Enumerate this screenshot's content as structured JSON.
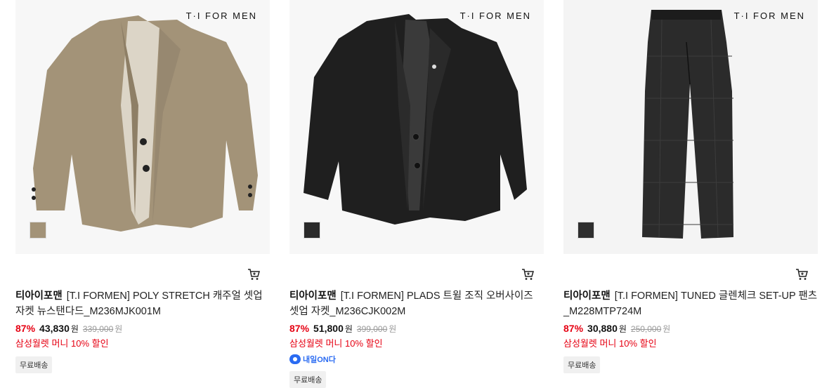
{
  "products": [
    {
      "brand_mark": "T·I FOR MEN",
      "brand": "티아이포맨",
      "title": "[T.I FORMEN] POLY STRETCH 캐주얼 셋업 자켓 뉴스탠다드_M236MJK001M",
      "discount": "87%",
      "price": "43,830",
      "price_unit": "원",
      "original_price": "339,000",
      "original_unit": "원",
      "benefit": "삼성월렛 머니 10% 할인",
      "shipping_badge": "무료배송",
      "swatch_color": "#a39378",
      "garment_color": "#a39378"
    },
    {
      "brand_mark": "T·I FOR MEN",
      "brand": "티아이포맨",
      "title": "[T.I FORMEN] PLADS 트윌 조직 오버사이즈 셋업 자켓_M236CJK002M",
      "discount": "87%",
      "price": "51,800",
      "price_unit": "원",
      "original_price": "399,000",
      "original_unit": "원",
      "benefit": "삼성월렛 머니 10% 할인",
      "delivery_tag": "내일ON다",
      "shipping_badge": "무료배송",
      "swatch_color": "#2a2a2a",
      "garment_color": "#1f1f1f"
    },
    {
      "brand_mark": "T·I FOR MEN",
      "brand": "티아이포맨",
      "title": "[T.I FORMEN] TUNED 글렌체크 SET-UP 팬츠_M228MTP724M",
      "discount": "87%",
      "price": "30,880",
      "price_unit": "원",
      "original_price": "250,000",
      "original_unit": "원",
      "benefit": "삼성월렛 머니 10% 할인",
      "shipping_badge": "무료배송",
      "swatch_color": "#2e2e2e",
      "garment_color": "#2b2b2b"
    }
  ],
  "icons": {
    "cart": "cart-icon",
    "delivery": "delivery-tag-icon"
  }
}
